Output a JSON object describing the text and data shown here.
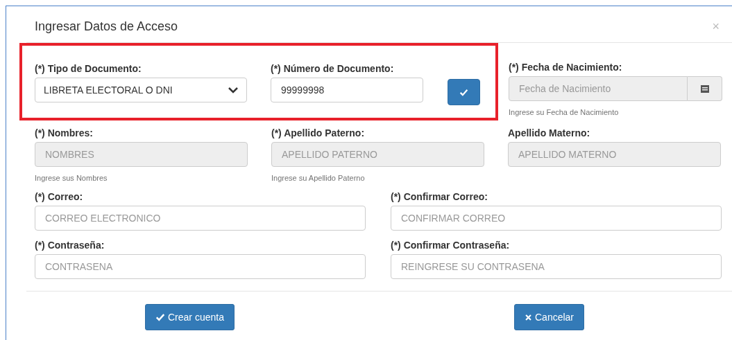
{
  "dialog": {
    "title": "Ingresar Datos de Acceso",
    "close": "×"
  },
  "document_section": {
    "highlighted": true,
    "type_field": {
      "label": "(*) Tipo de Documento:",
      "value": "LIBRETA ELECTORAL O DNI"
    },
    "number_field": {
      "label": "(*) Número de Documento:",
      "value": "99999998"
    },
    "verify_button": {
      "disabled": false
    }
  },
  "birth_date_field": {
    "label": "(*) Fecha de Nacimiento:",
    "placeholder": "Fecha de Nacimiento",
    "disabled": true,
    "help": "Ingrese su Fecha de Nacimiento"
  },
  "name_fields": [
    {
      "label": "(*) Nombres:",
      "placeholder": "NOMBRES",
      "disabled": true,
      "help": "Ingrese sus Nombres"
    },
    {
      "label": "(*) Apellido Paterno:",
      "placeholder": "APELLIDO PATERNO",
      "disabled": true,
      "help": "Ingrese su Apellido Paterno"
    },
    {
      "label": "Apellido Materno:",
      "placeholder": "APELLIDO MATERNO",
      "disabled": true
    }
  ],
  "account_fields": [
    {
      "label": "(*) Correo:",
      "placeholder": "CORREO ELECTRONICO",
      "disabled": false
    },
    {
      "label": "(*) Confirmar Correo:",
      "placeholder": "CONFIRMAR CORREO",
      "disabled": false
    },
    {
      "label": "(*) Contraseña:",
      "placeholder": "CONTRASENA",
      "disabled": false
    },
    {
      "label": "(*) Confirmar Contraseña:",
      "placeholder": "REINGRESE SU CONTRASENA",
      "disabled": false
    }
  ],
  "buttons": [
    {
      "kind": "confirm",
      "label": "Crear cuenta"
    },
    {
      "kind": "cancel",
      "label": "Cancelar"
    }
  ]
}
